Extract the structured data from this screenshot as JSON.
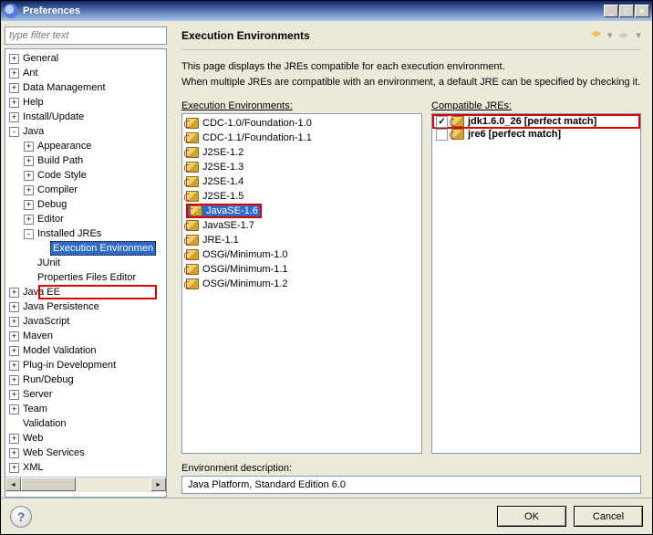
{
  "window": {
    "title": "Preferences",
    "filter_placeholder": "type filter text"
  },
  "tree": {
    "items": [
      {
        "label": "General",
        "level": 0,
        "expand": "+"
      },
      {
        "label": "Ant",
        "level": 0,
        "expand": "+"
      },
      {
        "label": "Data Management",
        "level": 0,
        "expand": "+"
      },
      {
        "label": "Help",
        "level": 0,
        "expand": "+"
      },
      {
        "label": "Install/Update",
        "level": 0,
        "expand": "+"
      },
      {
        "label": "Java",
        "level": 0,
        "expand": "-"
      },
      {
        "label": "Appearance",
        "level": 1,
        "expand": "+"
      },
      {
        "label": "Build Path",
        "level": 1,
        "expand": "+"
      },
      {
        "label": "Code Style",
        "level": 1,
        "expand": "+"
      },
      {
        "label": "Compiler",
        "level": 1,
        "expand": "+"
      },
      {
        "label": "Debug",
        "level": 1,
        "expand": "+"
      },
      {
        "label": "Editor",
        "level": 1,
        "expand": "+"
      },
      {
        "label": "Installed JREs",
        "level": 1,
        "expand": "-"
      },
      {
        "label": "Execution Environmen",
        "level": 2,
        "selected": true
      },
      {
        "label": "JUnit",
        "level": 1,
        "expand": ""
      },
      {
        "label": "Properties Files Editor",
        "level": 1,
        "expand": ""
      },
      {
        "label": "Java EE",
        "level": 0,
        "expand": "+"
      },
      {
        "label": "Java Persistence",
        "level": 0,
        "expand": "+"
      },
      {
        "label": "JavaScript",
        "level": 0,
        "expand": "+"
      },
      {
        "label": "Maven",
        "level": 0,
        "expand": "+"
      },
      {
        "label": "Model Validation",
        "level": 0,
        "expand": "+"
      },
      {
        "label": "Plug-in Development",
        "level": 0,
        "expand": "+"
      },
      {
        "label": "Run/Debug",
        "level": 0,
        "expand": "+"
      },
      {
        "label": "Server",
        "level": 0,
        "expand": "+"
      },
      {
        "label": "Team",
        "level": 0,
        "expand": "+"
      },
      {
        "label": "Validation",
        "level": 0,
        "expand": ""
      },
      {
        "label": "Web",
        "level": 0,
        "expand": "+"
      },
      {
        "label": "Web Services",
        "level": 0,
        "expand": "+"
      },
      {
        "label": "XML",
        "level": 0,
        "expand": "+"
      }
    ]
  },
  "main": {
    "title": "Execution Environments",
    "desc1": "This page displays the JREs compatible for each execution environment.",
    "desc2": "When multiple JREs are compatible with an environment, a default JRE can be specified by checking it.",
    "env_label": "Execution Environments:",
    "jre_label": "Compatible JREs:",
    "env_desc_label": "Environment description:",
    "env_desc_value": "Java Platform, Standard Edition 6.0",
    "envs": [
      "CDC-1.0/Foundation-1.0",
      "CDC-1.1/Foundation-1.1",
      "J2SE-1.2",
      "J2SE-1.3",
      "J2SE-1.4",
      "J2SE-1.5",
      "JavaSE-1.6",
      "JavaSE-1.7",
      "JRE-1.1",
      "OSGi/Minimum-1.0",
      "OSGi/Minimum-1.1",
      "OSGi/Minimum-1.2"
    ],
    "jres": [
      {
        "label": "jdk1.6.0_26 [perfect match]",
        "checked": true,
        "bold": true
      },
      {
        "label": "jre6 [perfect match]",
        "checked": false,
        "bold": true
      }
    ]
  },
  "buttons": {
    "ok": "OK",
    "cancel": "Cancel"
  }
}
